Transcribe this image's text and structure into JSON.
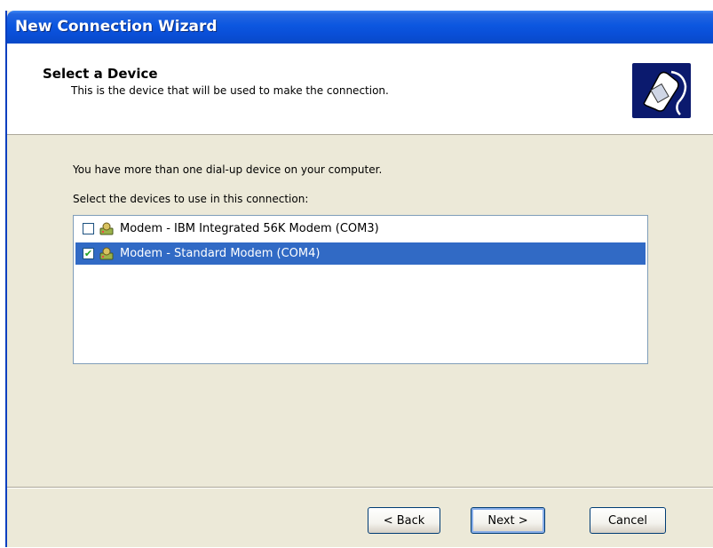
{
  "window": {
    "title": "New Connection Wizard"
  },
  "header": {
    "title": "Select a Device",
    "subtitle": "This is the device that will be used to make the connection.",
    "icon": "telephone-handset-icon"
  },
  "body": {
    "intro": "You have more than one dial-up device on your computer.",
    "select_label": "Select the devices to use in this connection:",
    "devices": [
      {
        "label": "Modem - IBM Integrated 56K Modem (COM3)",
        "checked": false,
        "selected": false
      },
      {
        "label": "Modem - Standard Modem (COM4)",
        "checked": true,
        "selected": true
      }
    ]
  },
  "buttons": {
    "back": "< Back",
    "next": "Next >",
    "cancel": "Cancel"
  },
  "colors": {
    "titlebar": "#0a4fd8",
    "selection": "#316ac5",
    "dialog_bg": "#ece9d8"
  }
}
